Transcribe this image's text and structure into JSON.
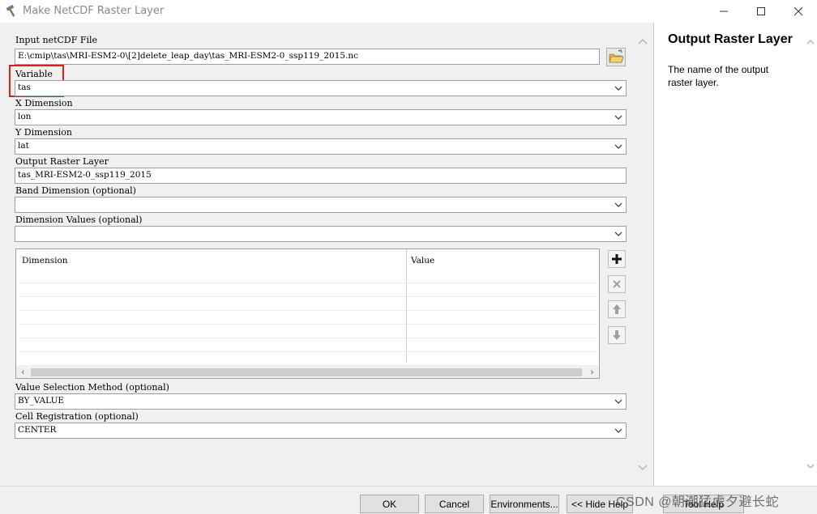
{
  "window": {
    "title": "Make NetCDF Raster Layer"
  },
  "form": {
    "input_file": {
      "label": "Input netCDF File",
      "value": "E:\\cmip\\tas\\MRI-ESM2-0\\[2]delete_leap_day\\tas_MRI-ESM2-0_ssp119_2015.nc"
    },
    "variable": {
      "label": "Variable",
      "value": "tas"
    },
    "x_dimension": {
      "label": "X Dimension",
      "value": "lon"
    },
    "y_dimension": {
      "label": "Y Dimension",
      "value": "lat"
    },
    "output_layer": {
      "label": "Output Raster Layer",
      "value": "tas_MRI-ESM2-0_ssp119_2015"
    },
    "band_dimension": {
      "label": "Band Dimension (optional)",
      "value": ""
    },
    "dimension_values": {
      "label": "Dimension Values (optional)",
      "value": "",
      "columns": [
        "Dimension",
        "Value"
      ]
    },
    "value_selection": {
      "label": "Value Selection Method (optional)",
      "value": "BY_VALUE"
    },
    "cell_registration": {
      "label": "Cell Registration (optional)",
      "value": "CENTER"
    }
  },
  "help": {
    "title": "Output Raster Layer",
    "text": "The name of the output raster layer."
  },
  "buttons": {
    "ok": "OK",
    "cancel": "Cancel",
    "environments": "Environments...",
    "hide_help": "<< Hide Help",
    "tool_help": "Tool Help"
  },
  "watermark": "CSDN @朝潮猛虎夕避长蛇",
  "colors": {
    "highlight": "#e02020"
  }
}
